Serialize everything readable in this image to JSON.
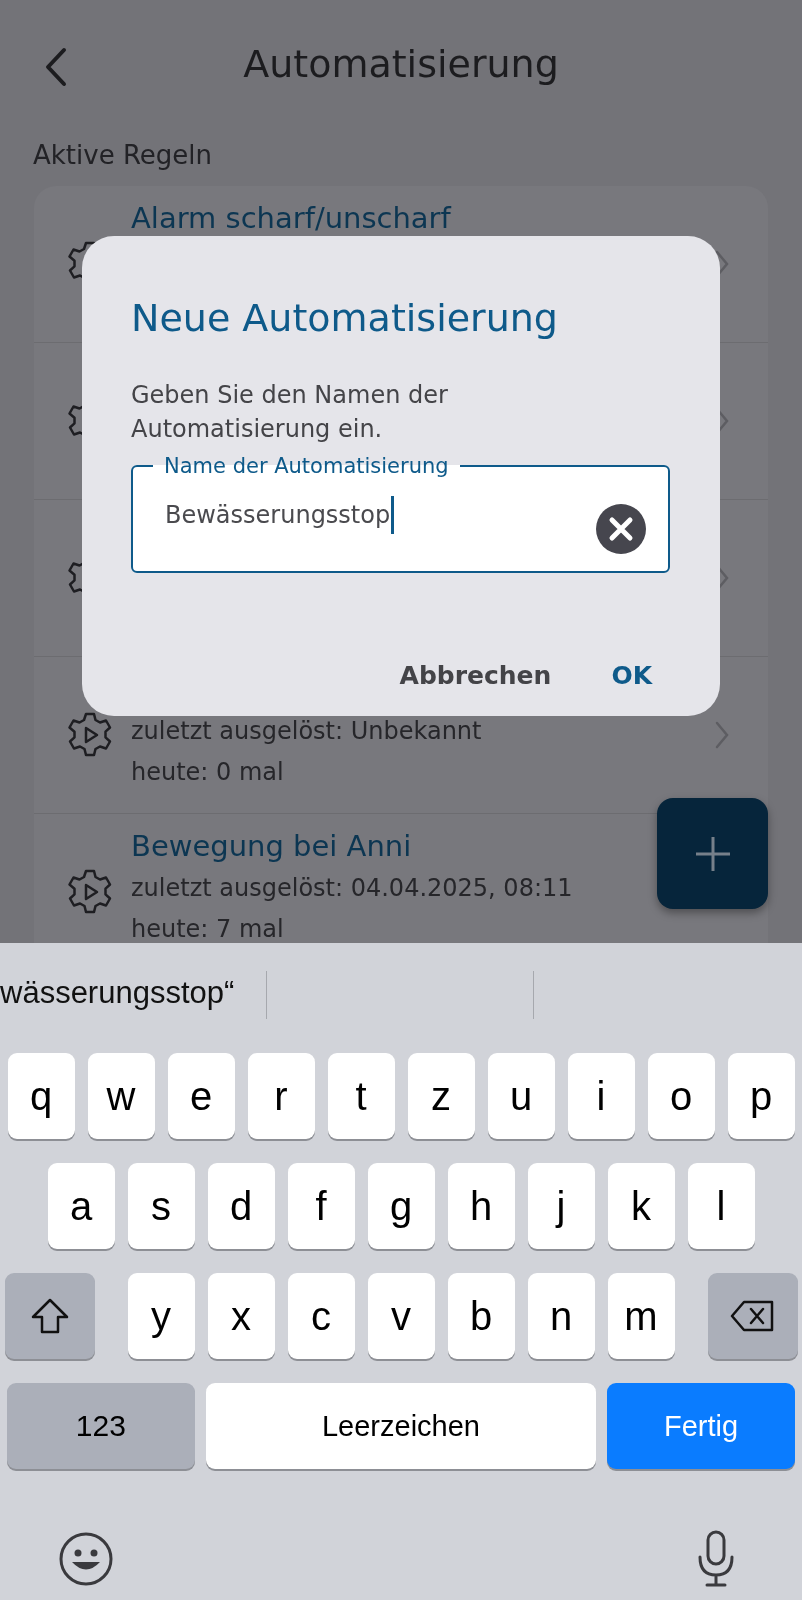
{
  "header": {
    "title": "Automatisierung"
  },
  "section_label": "Aktive Regeln",
  "rules": [
    {
      "kind": "rule",
      "title": "Alarm scharf/unscharf"
    },
    {
      "kind": "rule"
    },
    {
      "kind": "rule"
    },
    {
      "kind": "rule",
      "last_triggered": "zuletzt ausgelöst: Unbekannt",
      "today": "heute: 0 mal"
    },
    {
      "kind": "rule",
      "title": "Bewegung bei Anni",
      "last_triggered": "zuletzt ausgelöst: 04.04.2025, 08:11",
      "today": "heute: 7 mal"
    }
  ],
  "dialog": {
    "title": "Neue Automatisierung",
    "message": "Geben Sie den Namen der Automatisierung ein.",
    "field": {
      "label": "Name der Automatisierung",
      "value": "Bewässerungsstop"
    },
    "buttons": [
      {
        "label": "Abbrechen",
        "kind": "cancel"
      },
      {
        "label": "OK",
        "kind": "confirm"
      }
    ]
  },
  "keyboard": {
    "suggestion": "wässerungsstop“",
    "rows": [
      [
        "q",
        "w",
        "e",
        "r",
        "t",
        "z",
        "u",
        "i",
        "o",
        "p"
      ],
      [
        "a",
        "s",
        "d",
        "f",
        "g",
        "h",
        "j",
        "k",
        "l"
      ],
      [
        "y",
        "x",
        "c",
        "v",
        "b",
        "n",
        "m"
      ]
    ],
    "bottom": [
      {
        "label": "123",
        "kind": "mode"
      },
      {
        "label": "Leerzeichen",
        "kind": "space"
      },
      {
        "label": "Fertig",
        "kind": "done"
      }
    ]
  }
}
